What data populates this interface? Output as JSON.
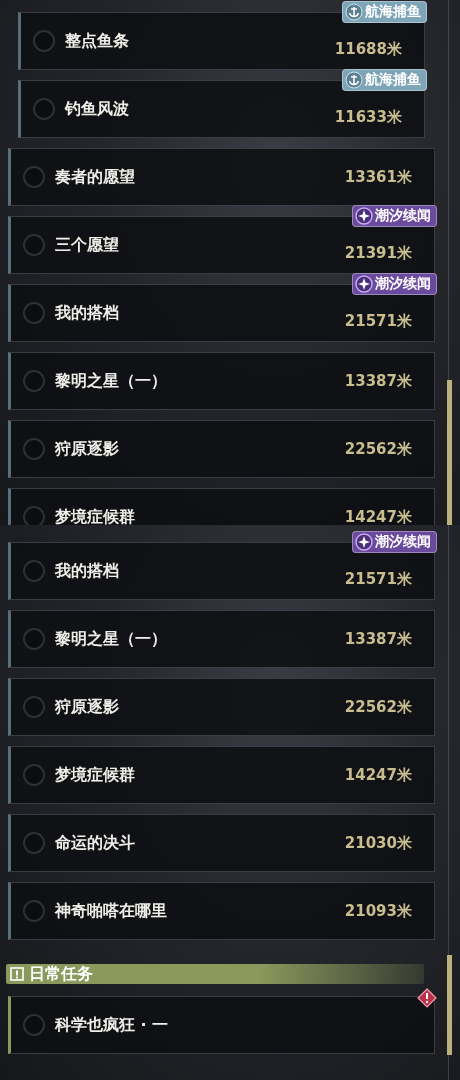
{
  "panels": [
    {
      "quests": [
        {
          "title": "整点鱼条",
          "distance": "11688米",
          "kind": "nested",
          "checked": false,
          "tag": {
            "kind": "voyage",
            "text": "航海捕鱼"
          }
        },
        {
          "title": "钓鱼风波",
          "distance": "11633米",
          "kind": "nested",
          "checked": false,
          "tag": {
            "kind": "voyage",
            "text": "航海捕鱼"
          }
        },
        {
          "title": "奏者的愿望",
          "distance": "13361米",
          "kind": "top",
          "checked": false
        },
        {
          "title": "三个愿望",
          "distance": "21391米",
          "kind": "top",
          "checked": false,
          "tag": {
            "kind": "tide",
            "text": "潮汐续闻"
          }
        },
        {
          "title": "我的搭档",
          "distance": "21571米",
          "kind": "top",
          "checked": false,
          "tag": {
            "kind": "tide",
            "text": "潮汐续闻"
          }
        },
        {
          "title": "黎明之星（一）",
          "distance": "13387米",
          "kind": "top",
          "checked": false
        },
        {
          "title": "狩原逐影",
          "distance": "22562米",
          "kind": "top",
          "checked": false
        },
        {
          "title": "梦境症候群",
          "distance": "14247米",
          "kind": "top",
          "checked": false
        }
      ]
    },
    {
      "quests": [
        {
          "title": "我的搭档",
          "distance": "21571米",
          "kind": "top",
          "checked": false,
          "tag": {
            "kind": "tide",
            "text": "潮汐续闻"
          }
        },
        {
          "title": "黎明之星（一）",
          "distance": "13387米",
          "kind": "top",
          "checked": false
        },
        {
          "title": "狩原逐影",
          "distance": "22562米",
          "kind": "top",
          "checked": false
        },
        {
          "title": "梦境症候群",
          "distance": "14247米",
          "kind": "top",
          "checked": false
        },
        {
          "title": "命运的决斗",
          "distance": "21030米",
          "kind": "top",
          "checked": false
        },
        {
          "title": "神奇啪嗒在哪里",
          "distance": "21093米",
          "kind": "top",
          "checked": false
        }
      ],
      "section": {
        "title": "日常任务",
        "quests": [
          {
            "title": "科学也疯狂 · 一",
            "kind": "daily",
            "checked": false,
            "alert": true
          }
        ]
      }
    }
  ]
}
